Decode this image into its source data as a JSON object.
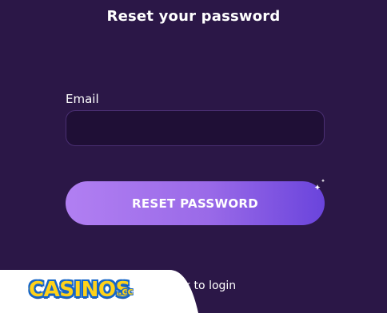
{
  "page": {
    "title": "Reset your password"
  },
  "form": {
    "email_label": "Email",
    "email_value": "",
    "email_placeholder": "",
    "submit_label": "RESET PASSWORD"
  },
  "footer": {
    "back_link_label": "k to login"
  },
  "watermark": {
    "brand_main": "CASINOS",
    "brand_suffix": ".cc"
  },
  "colors": {
    "background": "#2b1747",
    "input_bg": "#1f0f36",
    "button_gradient_start": "#b17ff2",
    "button_gradient_end": "#6a44dc",
    "logo_yellow": "#ffd21a",
    "logo_blue": "#1565c8"
  },
  "icons": {
    "sparkle": "sparkle-icon"
  }
}
